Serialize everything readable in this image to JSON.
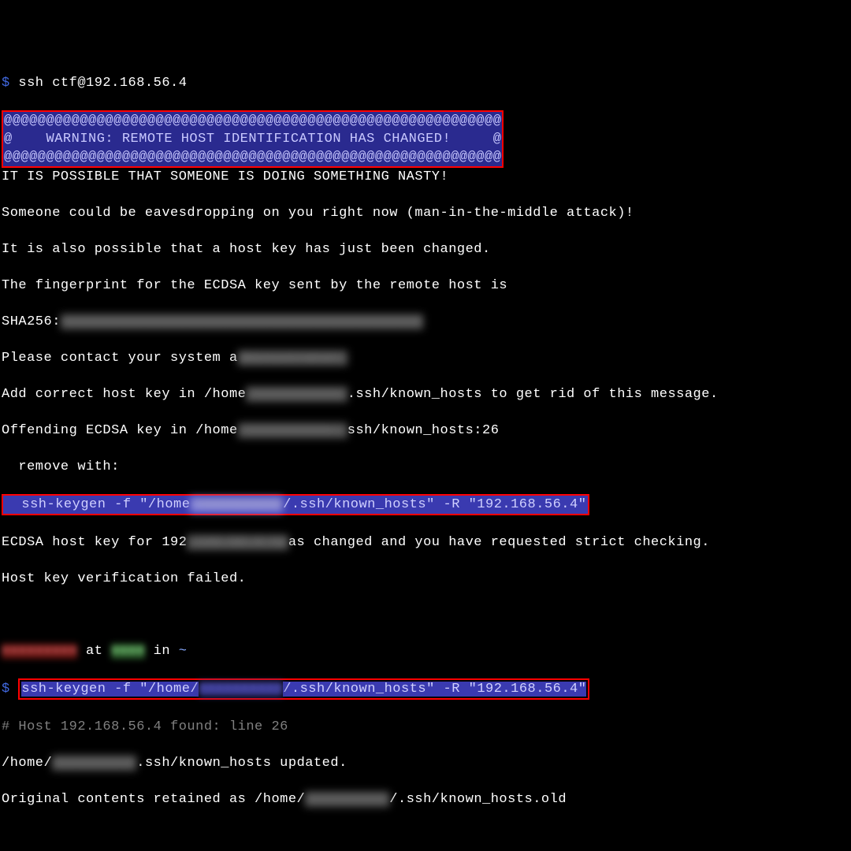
{
  "prompt1": {
    "dollar": "$",
    "cmd": "ssh ctf@192.168.56.4"
  },
  "warn": {
    "row_at": "@@@@@@@@@@@@@@@@@@@@@@@@@@@@@@@@@@@@@@@@@@@@@@@@@@@@@@@@@@@",
    "text": "@    WARNING: REMOTE HOST IDENTIFICATION HAS CHANGED!     @"
  },
  "body": {
    "l1": "IT IS POSSIBLE THAT SOMEONE IS DOING SOMETHING NASTY!",
    "l2": "Someone could be eavesdropping on you right now (man-in-the-middle attack)!",
    "l3": "It is also possible that a host key has just been changed.",
    "l4": "The fingerprint for the ECDSA key sent by the remote host is",
    "l5a": "SHA256:",
    "l5_blur": "XXXXXXXXXXXXXXXXXXXXXXXXXXXXXXXXXXXXXXXXXXX",
    "l6a": "Please contact your system a",
    "l6_blur": "dministrator.",
    "l7a": "Add correct host key in /home",
    "l7_blur": "/XXXXXXXXXX/",
    "l7b": ".ssh/known_hosts to get rid of this message.",
    "l8a": "Offending ECDSA key in /home",
    "l8_blur": "/XXXXXXXXXX/.",
    "l8b": "ssh/known_hosts:26",
    "l9": "  remove with:",
    "l10a": "  ssh-keygen -f \"/home",
    "l10_blur": "/XXXXXXXXXX",
    "l10b": "/.ssh/known_hosts\" -R \"192.168.56.4\"",
    "l11a": "ECDSA host key for 192",
    "l11_blur": ".168.56.4 ha",
    "l11b": "as changed and you have requested strict checking.",
    "l12": "Host key verification failed."
  },
  "prompt2": {
    "user_blur": "■■■■■■■■■",
    "at": " at ",
    "host_blur": "■■■■",
    "in": " in ",
    "tilde": "~"
  },
  "prompt3": {
    "dollar": "$",
    "cmd_a": "ssh-keygen -f \"/home/",
    "cmd_blur": "XXXXXXXXXX",
    "cmd_b": "/.ssh/known_hosts\" -R \"192.168.56.4\""
  },
  "out": {
    "l1": "# Host 192.168.56.4 found: line 26",
    "l2a": "/home/",
    "l2_blur": "XXXXXXXXXX",
    "l2b": ".ssh/known_hosts updated.",
    "l3a": "Original contents retained as /home/",
    "l3_blur": "XXXXXXXXXX",
    "l3b": "/.ssh/known_hosts.old"
  }
}
